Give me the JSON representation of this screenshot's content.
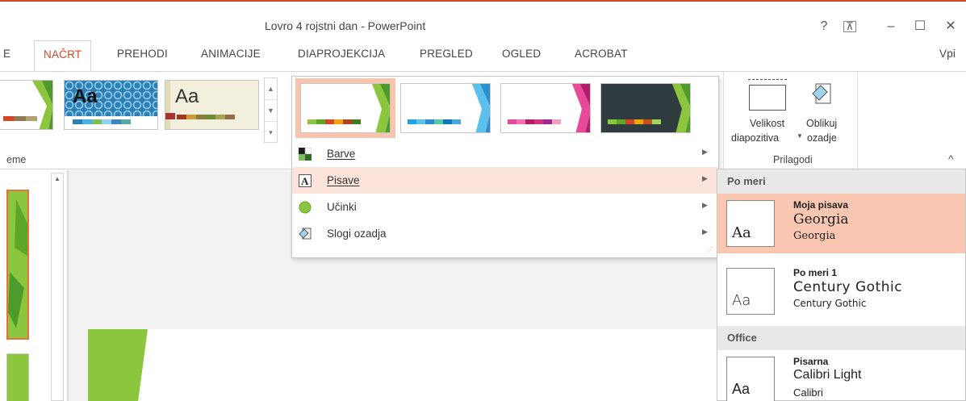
{
  "window": {
    "title": "Lovro 4 rojstni dan - PowerPoint",
    "help": "?",
    "ribbon_display": "⊼",
    "minimize": "–",
    "maximize": "☐",
    "close": "✕",
    "accent_color": "#d24726"
  },
  "tabs": {
    "partial_left": "E",
    "design": "NAČRT",
    "transitions": "PREHODI",
    "animations": "ANIMACIJE",
    "slideshow": "DIAPROJEKCIJA",
    "review": "PREGLED",
    "view": "OGLED",
    "acrobat": "ACROBAT",
    "signin_partial": "Vpi"
  },
  "ribbon": {
    "themes_group_label": "eme",
    "theme_thumb_text": "Aa",
    "customize_group_label": "Prilagodi",
    "slide_size_label_1": "Velikost",
    "slide_size_label_2": "diapozitiva",
    "format_bg_label_1": "Oblikuj",
    "format_bg_label_2": "ozadje",
    "collapse_icon": "^"
  },
  "variants_menu": {
    "items": [
      {
        "label": "Barve",
        "icon": "colors-icon"
      },
      {
        "label": "Pisave",
        "icon": "fonts-icon"
      },
      {
        "label": "Učinki",
        "icon": "effects-icon"
      },
      {
        "label": "Slogi ozadja",
        "icon": "background-styles-icon"
      }
    ]
  },
  "fonts_submenu": {
    "custom_header": "Po meri",
    "office_header": "Office",
    "preview_glyph": "Aa",
    "items": [
      {
        "name": "Moja pisava",
        "heading": "Georgia",
        "body": "Georgia"
      },
      {
        "name": "Po meri 1",
        "heading": "Century Gothic",
        "body": "Century Gothic"
      },
      {
        "name": "Pisarna",
        "heading": "Calibri Light",
        "body": "Calibri"
      }
    ]
  }
}
